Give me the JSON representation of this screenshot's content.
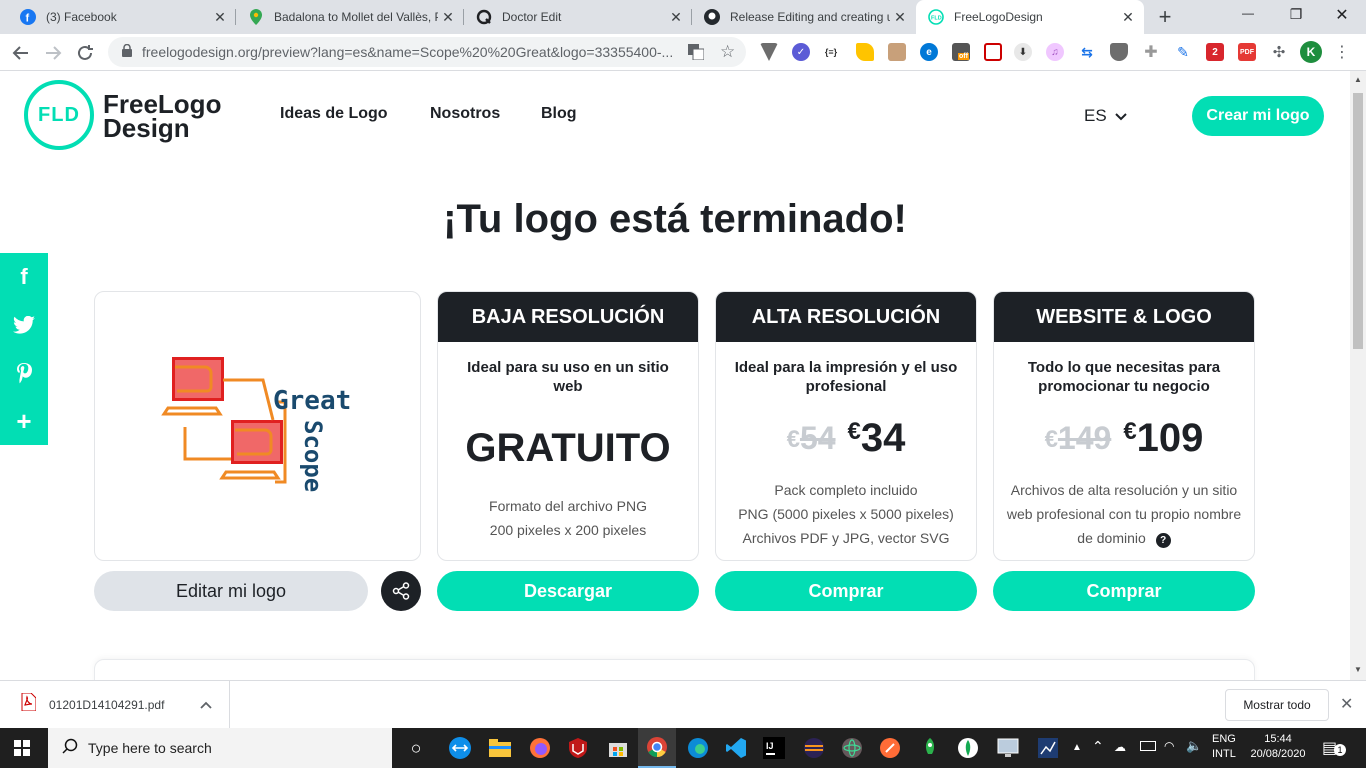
{
  "tabs": [
    {
      "label": "(3) Facebook",
      "icon": "facebook-icon"
    },
    {
      "label": "Badalona to Mollet del Vallès, P",
      "icon": "maps-icon"
    },
    {
      "label": "Doctor Edit",
      "icon": "doctor-edit-icon"
    },
    {
      "label": "Release Editing and creating us",
      "icon": "github-icon"
    },
    {
      "label": "FreeLogoDesign",
      "icon": "fld-icon"
    }
  ],
  "tab_close": "✕",
  "new_tab": "+",
  "window_controls": {
    "minimize": "—",
    "maximize": "❐",
    "close": "✕"
  },
  "toolbar": {
    "url": "freelogodesign.org/preview?lang=es&name=Scope%20%20Great&logo=33355400-..."
  },
  "site": {
    "logo_mark": "FLD",
    "logo_text_1": "FreeLogo",
    "logo_text_2": "Design",
    "nav": [
      "Ideas de Logo",
      "Nosotros",
      "Blog"
    ],
    "language": "ES",
    "cta": "Crear mi logo"
  },
  "main": {
    "heading": "¡Tu logo está terminado!",
    "logo_preview": {
      "word1": "Great",
      "word2": "Scope"
    },
    "edit_button": "Editar mi logo",
    "plans": [
      {
        "title": "BAJA RESOLUCIÓN",
        "desc": "Ideal para su uso en un sitio web",
        "price": "GRATUITO",
        "old_price": "",
        "details": [
          "Formato del archivo PNG",
          "200 pixeles x 200 pixeles"
        ],
        "button": "Descargar"
      },
      {
        "title": "ALTA RESOLUCIÓN",
        "desc": "Ideal para la impresión y el uso profesional",
        "price": "34",
        "old_price": "54",
        "currency": "€",
        "details": [
          "Pack completo incluido",
          "PNG (5000 pixeles x 5000 pixeles)",
          "Archivos PDF y JPG, vector SVG"
        ],
        "button": "Comprar"
      },
      {
        "title": "WEBSITE & LOGO",
        "desc": "Todo lo que necesitas para promocionar tu negocio",
        "price": "109",
        "old_price": "149",
        "currency": "€",
        "details": [
          "Archivos de alta resolución y un sitio",
          "web profesional con tu propio nombre",
          "de dominio"
        ],
        "button": "Comprar"
      }
    ]
  },
  "social": [
    "f",
    "twitter",
    "pinterest",
    "+"
  ],
  "download_bar": {
    "file": "01201D14104291.pdf",
    "show_all": "Mostrar todo"
  },
  "taskbar": {
    "search_placeholder": "Type here to search",
    "lang_1": "ENG",
    "lang_2": "INTL",
    "time": "15:44",
    "date": "20/08/2020",
    "notif": "1"
  },
  "colors": {
    "brand": "#02deb4",
    "dark": "#1d2126",
    "logo_blue": "#1a4a6e",
    "logo_orange": "#f08a24",
    "logo_red": "#e02020"
  }
}
